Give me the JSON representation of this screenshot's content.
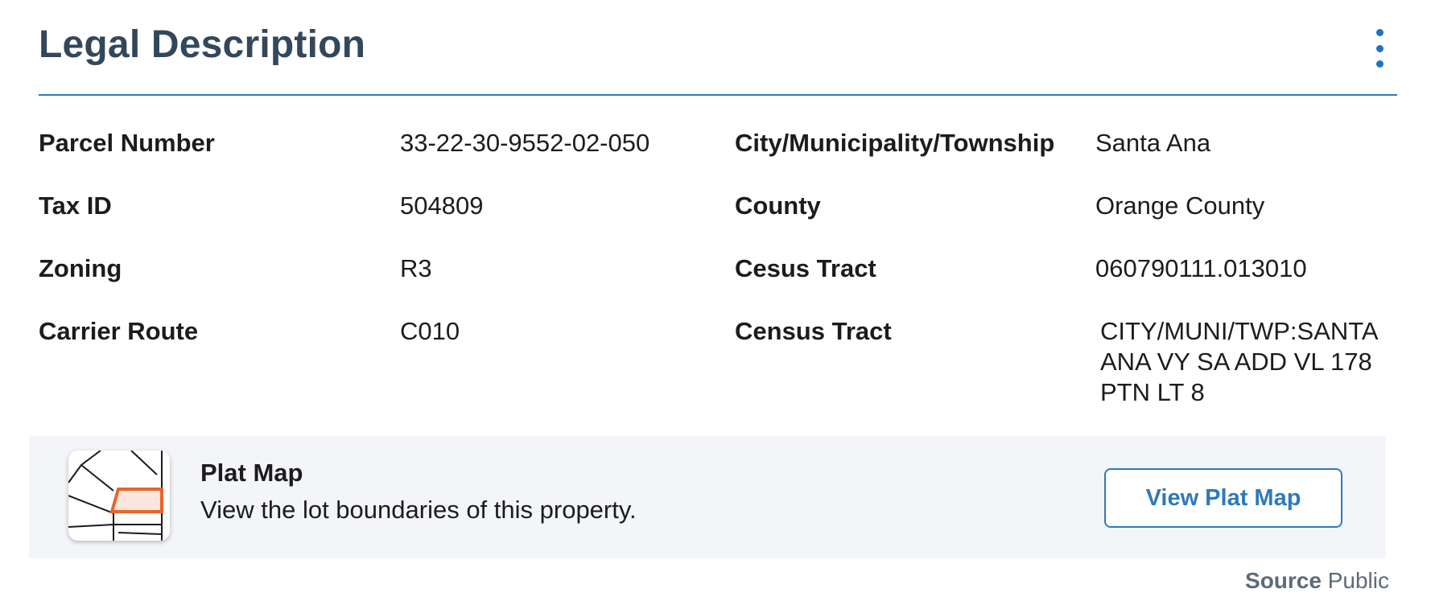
{
  "header": {
    "title": "Legal Description",
    "menu_icon": "more-vertical-icon",
    "accent_color": "#1a73c7"
  },
  "fields": {
    "parcel_number": {
      "label": "Parcel Number",
      "value": "33-22-30-9552-02-050"
    },
    "city": {
      "label": "City/Municipality/Township",
      "value": "Santa Ana"
    },
    "tax_id": {
      "label": "Tax ID",
      "value": "504809"
    },
    "county": {
      "label": "County",
      "value": "Orange County"
    },
    "zoning": {
      "label": "Zoning",
      "value": "R3"
    },
    "cesus_tract": {
      "label": "Cesus Tract",
      "value": "060790111.013010"
    },
    "carrier_route": {
      "label": "Carrier Route",
      "value": "C010"
    },
    "census_tract": {
      "label": "Census Tract",
      "value_lines": [
        "CITY/MUNI/TWP:SANTA",
        "ANA VY SA ADD VL 178",
        "PTN LT 8"
      ]
    }
  },
  "plat_map": {
    "icon": "plat-map-thumbnail-icon",
    "title": "Plat Map",
    "subtitle": "View the lot boundaries of this property.",
    "button_label": "View Plat Map",
    "highlight_color": "#e8642a"
  },
  "footer": {
    "source_label": "Source",
    "source_value": "Public"
  }
}
